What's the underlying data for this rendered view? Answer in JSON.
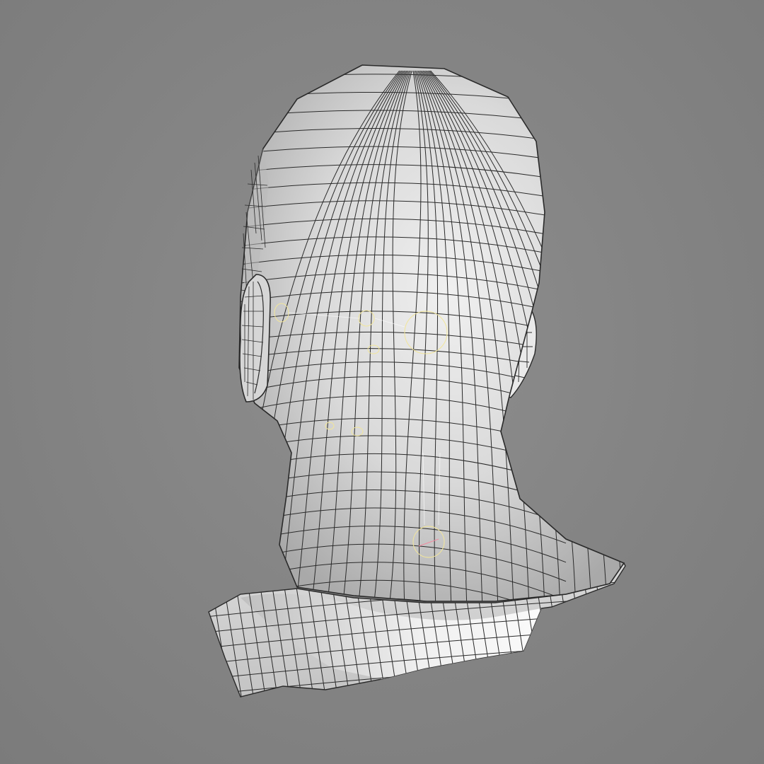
{
  "viewport": {
    "background": "#858585",
    "mesh_fill": "#e2e2e2",
    "wire_color": "#2a2a2a",
    "helper_color": "#f2e69a",
    "subject": "head-mesh-back-view",
    "helpers": [
      "ear-joint-helper",
      "skull-joint-helper",
      "head-joint-helper",
      "jaw-joint-helper",
      "neck-joint-helper",
      "neck-base-joint-helper"
    ]
  }
}
